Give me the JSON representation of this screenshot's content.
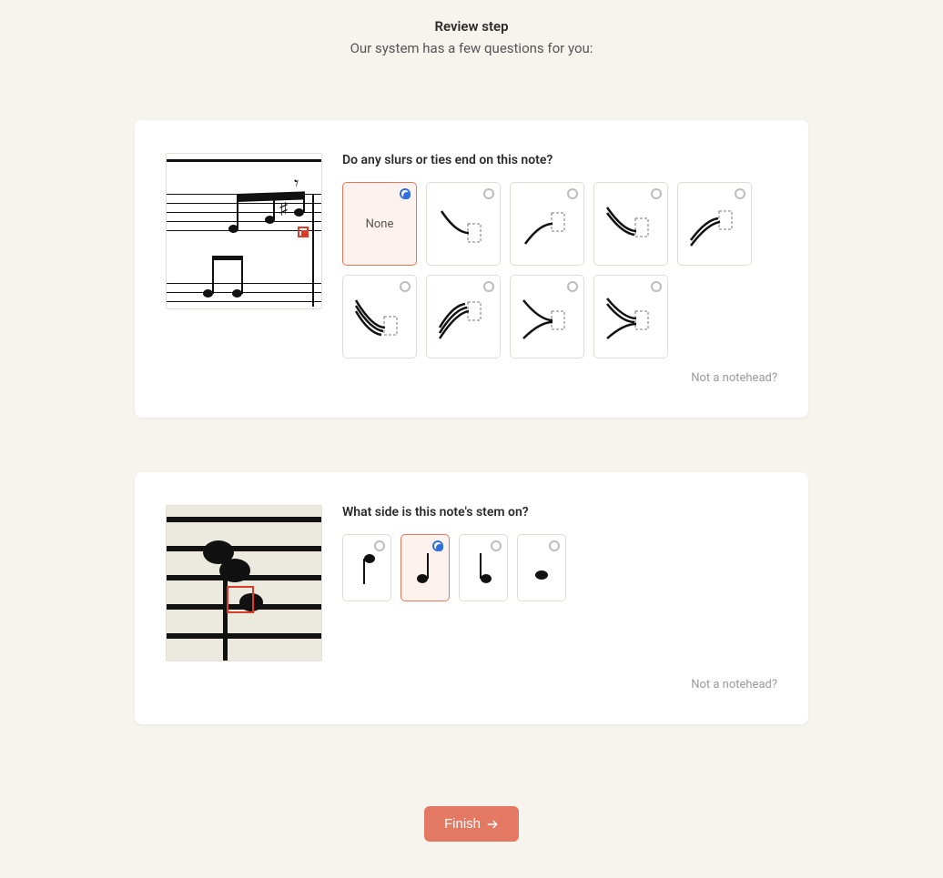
{
  "header": {
    "title": "Review step",
    "subtitle": "Our system has a few questions for you:"
  },
  "card1": {
    "question": "Do any slurs or ties end on this note?",
    "none_label": "None",
    "not_notehead": "Not a notehead?"
  },
  "card2": {
    "question": "What side is this note's stem on?",
    "not_notehead": "Not a notehead?"
  },
  "finish_label": "Finish"
}
